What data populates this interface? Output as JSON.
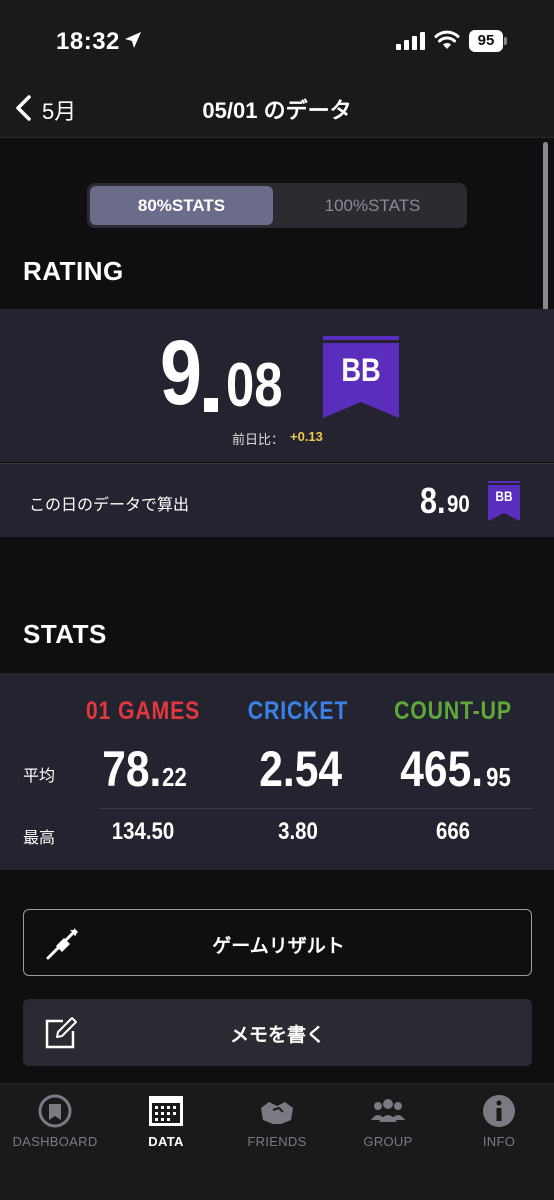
{
  "status_bar": {
    "time": "18:32",
    "battery": "95"
  },
  "nav": {
    "back_label": "5月",
    "title": "05/01 のデータ"
  },
  "segment": {
    "active": "80%STATS",
    "inactive": "100%STATS"
  },
  "rating": {
    "section_title": "RATING",
    "value_int": "9",
    "value_dec": "08",
    "flight_class": "BB",
    "diff_label": "前日比：",
    "diff_value": "+0.13",
    "day_calc_label": "この日のデータで算出",
    "day_value_int": "8.",
    "day_value_dec": "90",
    "day_flight_class": "BB"
  },
  "stats": {
    "section_title": "STATS",
    "columns": [
      {
        "name": "01 GAMES",
        "color": "#e0383e",
        "avg_int": "78.",
        "avg_dec": "22",
        "max": "134.50"
      },
      {
        "name": "CRICKET",
        "color": "#3b82e8",
        "avg_int": "2.54",
        "avg_dec": "",
        "max": "3.80"
      },
      {
        "name": "COUNT-UP",
        "color": "#5fa83a",
        "avg_int": "465.",
        "avg_dec": "95",
        "max": "666"
      }
    ],
    "avg_label": "平均",
    "max_label": "最高"
  },
  "buttons": {
    "game_result": "ゲームリザルト",
    "memo": "メモを書く"
  },
  "tabs": [
    {
      "label": "DASHBOARD",
      "icon": "dashboard-icon",
      "active": false
    },
    {
      "label": "DATA",
      "icon": "calendar-icon",
      "active": true
    },
    {
      "label": "FRIENDS",
      "icon": "friends-icon",
      "active": false
    },
    {
      "label": "GROUP",
      "icon": "group-icon",
      "active": false
    },
    {
      "label": "INFO",
      "icon": "info-icon",
      "active": false
    }
  ],
  "colors": {
    "flight_purple": "#5b2dbd",
    "accent_active": "#6b6b8a",
    "diff_yellow": "#f2c94c"
  }
}
